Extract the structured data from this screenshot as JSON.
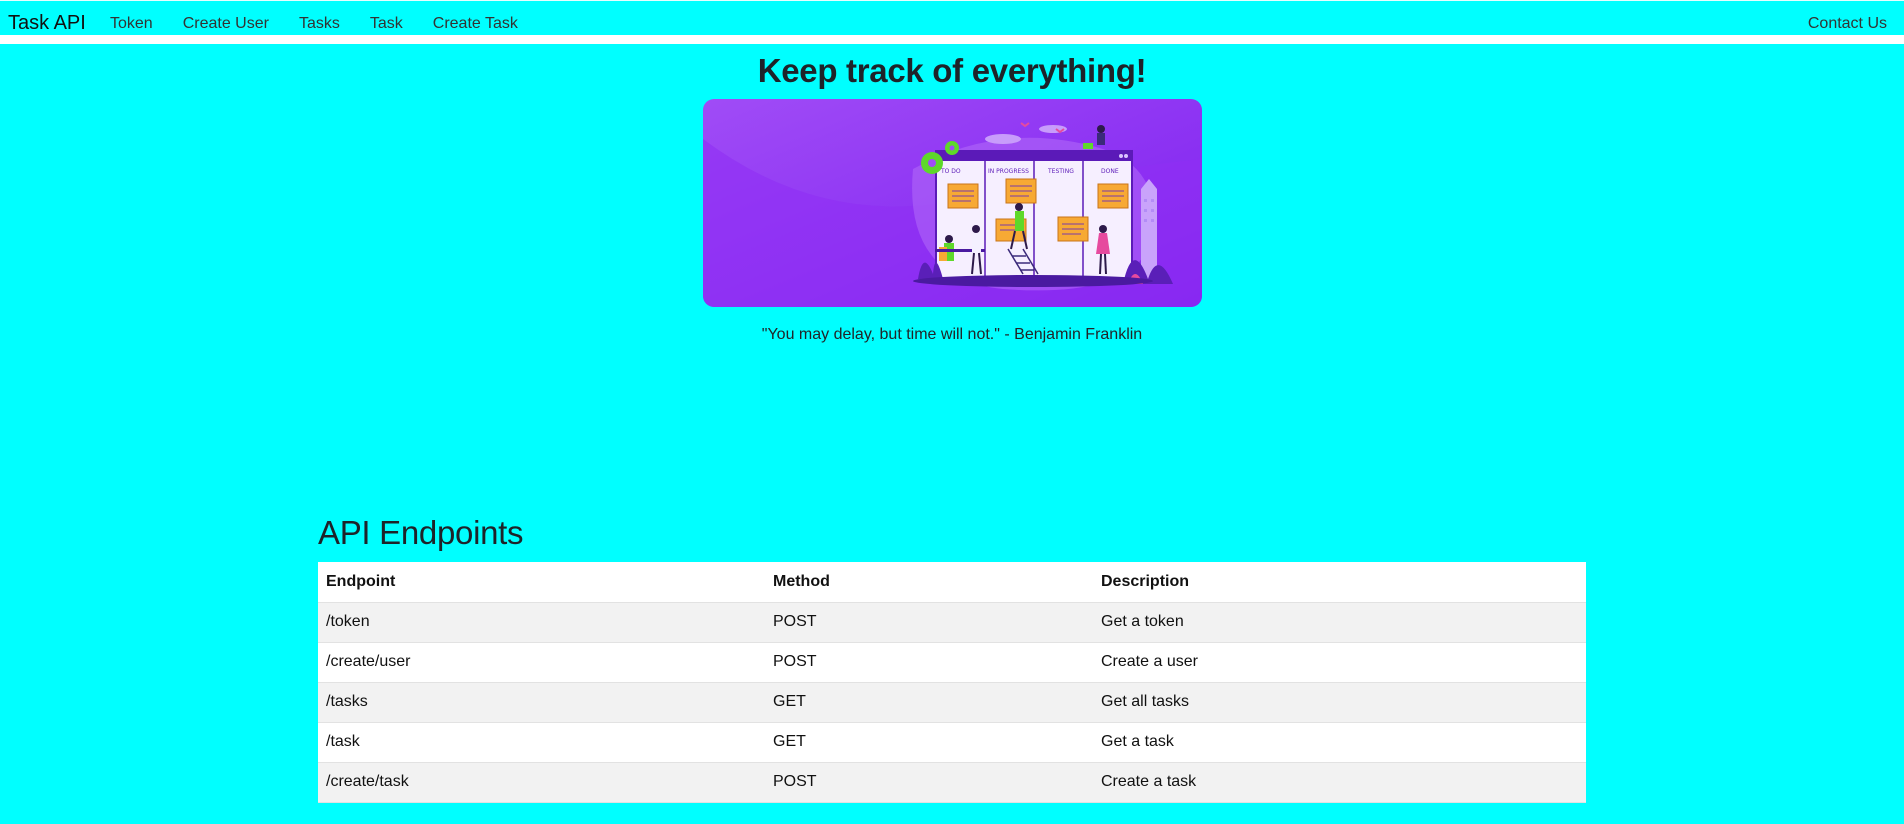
{
  "navbar": {
    "brand": "Task API",
    "links": [
      "Token",
      "Create User",
      "Tasks",
      "Task",
      "Create Task"
    ],
    "right_link": "Contact Us"
  },
  "hero": {
    "title": "Keep track of everything!",
    "image_icon": "kanban-board-illustration",
    "board_columns": [
      "TO DO",
      "IN PROGRESS",
      "TESTING",
      "DONE"
    ],
    "quote": "\"You may delay, but time will not.\" - Benjamin Franklin"
  },
  "endpoints": {
    "title": "API Endpoints",
    "headers": [
      "Endpoint",
      "Method",
      "Description"
    ],
    "rows": [
      [
        "/token",
        "POST",
        "Get a token"
      ],
      [
        "/create/user",
        "POST",
        "Create a user"
      ],
      [
        "/tasks",
        "GET",
        "Get all tasks"
      ],
      [
        "/task",
        "GET",
        "Get a task"
      ],
      [
        "/create/task",
        "POST",
        "Create a task"
      ]
    ]
  },
  "colors": {
    "background": "#00ffff",
    "hero_purple": "#8a2be2",
    "note_orange": "#f7a934"
  }
}
